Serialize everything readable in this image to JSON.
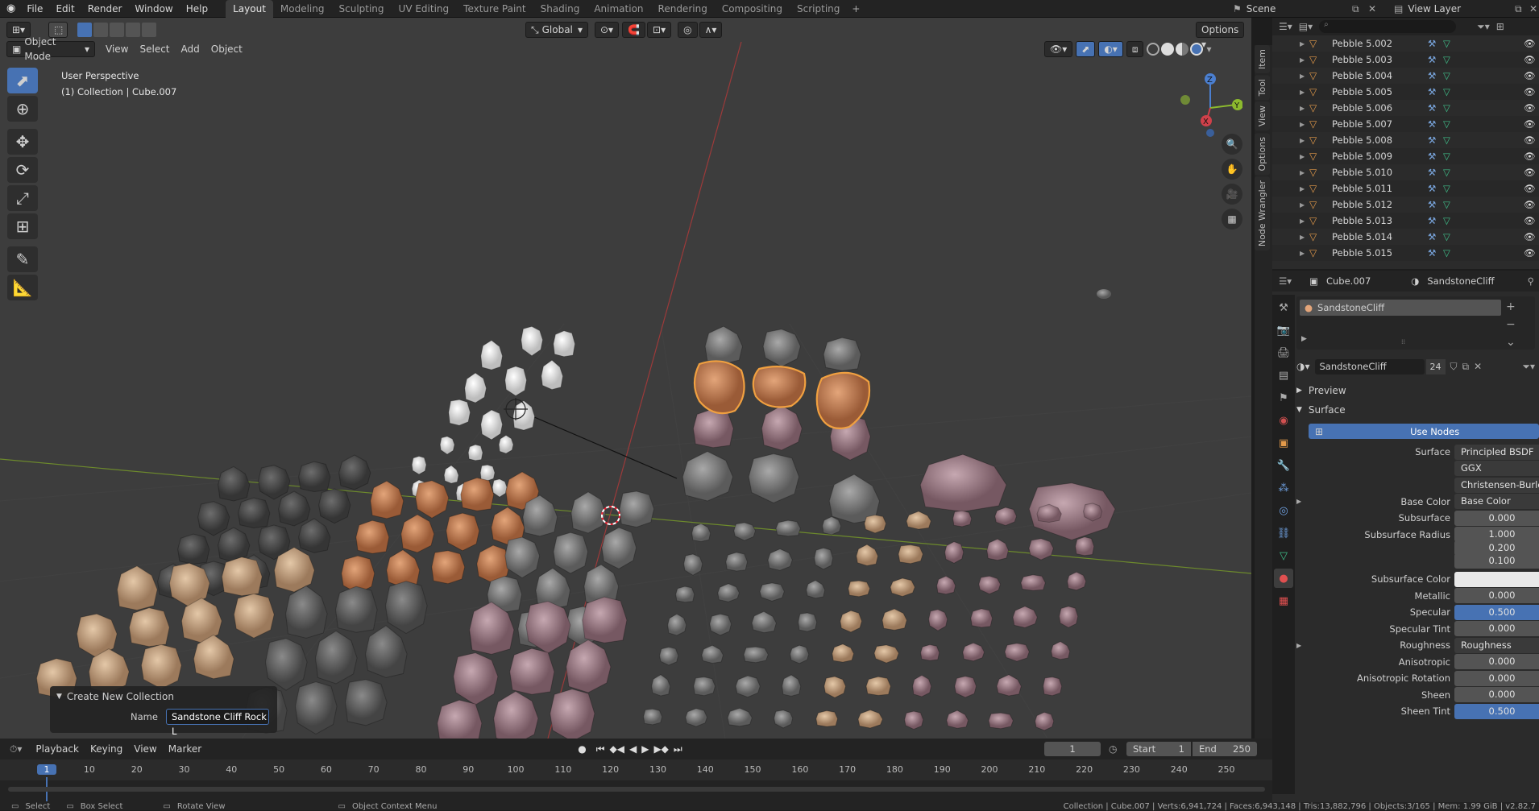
{
  "topbar": {
    "menus": [
      "File",
      "Edit",
      "Render",
      "Window",
      "Help"
    ],
    "workspaces": [
      "Layout",
      "Modeling",
      "Sculpting",
      "UV Editing",
      "Texture Paint",
      "Shading",
      "Animation",
      "Rendering",
      "Compositing",
      "Scripting"
    ],
    "active_workspace": "Layout",
    "plus": "+",
    "scene": "Scene",
    "view_layer": "View Layer"
  },
  "viewport": {
    "mode": "Object Mode",
    "menus": [
      "View",
      "Select",
      "Add",
      "Object"
    ],
    "transform_orientation": "Global",
    "options": "Options",
    "info_line1": "User Perspective",
    "info_line2": "(1) Collection | Cube.007",
    "gizmo": {
      "z": "Z",
      "y": "Y",
      "x": "X"
    },
    "side_tabs": [
      "Item",
      "Tool",
      "View",
      "Options",
      "Node Wrangler"
    ]
  },
  "popup": {
    "title": "Create New Collection",
    "name_label": "Name",
    "name_value": "Sandstone Cliff Rock L"
  },
  "outliner": {
    "items": [
      "Pebble 5.002",
      "Pebble 5.003",
      "Pebble 5.004",
      "Pebble 5.005",
      "Pebble 5.006",
      "Pebble 5.007",
      "Pebble 5.008",
      "Pebble 5.009",
      "Pebble 5.010",
      "Pebble 5.011",
      "Pebble 5.012",
      "Pebble 5.013",
      "Pebble 5.014",
      "Pebble 5.015"
    ]
  },
  "properties": {
    "object": "Cube.007",
    "material": "SandstoneCliff",
    "slot": "SandstoneCliff",
    "material_name": "SandstoneCliff",
    "users": "24",
    "preview": "Preview",
    "surface_panel": "Surface",
    "use_nodes": "Use Nodes",
    "rows": [
      {
        "label": "Surface",
        "value": "Principled BSDF",
        "style": "dark"
      },
      {
        "label": "",
        "value": "GGX",
        "style": "dark"
      },
      {
        "label": "",
        "value": "Christensen-Burley",
        "style": "dark"
      },
      {
        "label": "Base Color",
        "value": "Base Color",
        "style": "dark"
      },
      {
        "label": "Subsurface",
        "value": "0.000",
        "style": "num"
      },
      {
        "label": "Subsurface Radius",
        "value": "1.000",
        "style": "num"
      },
      {
        "label": "",
        "value": "0.200",
        "style": "num"
      },
      {
        "label": "",
        "value": "0.100",
        "style": "num"
      },
      {
        "label": "Subsurface Color",
        "value": "",
        "style": "white"
      },
      {
        "label": "Metallic",
        "value": "0.000",
        "style": "num"
      },
      {
        "label": "Specular",
        "value": "0.500",
        "style": "blue"
      },
      {
        "label": "Specular Tint",
        "value": "0.000",
        "style": "num"
      },
      {
        "label": "Roughness",
        "value": "Roughness",
        "style": "dark"
      },
      {
        "label": "Anisotropic",
        "value": "0.000",
        "style": "num"
      },
      {
        "label": "Anisotropic Rotation",
        "value": "0.000",
        "style": "num"
      },
      {
        "label": "Sheen",
        "value": "0.000",
        "style": "num"
      },
      {
        "label": "Sheen Tint",
        "value": "0.500",
        "style": "blue"
      }
    ]
  },
  "timeline": {
    "menus": [
      "Playback",
      "Keying",
      "View",
      "Marker"
    ],
    "current_frame": "1",
    "start_label": "Start",
    "start": "1",
    "end_label": "End",
    "end": "250",
    "ticks": [
      "1",
      "10",
      "20",
      "30",
      "40",
      "50",
      "60",
      "70",
      "80",
      "90",
      "100",
      "110",
      "120",
      "130",
      "140",
      "150",
      "160",
      "170",
      "180",
      "190",
      "200",
      "210",
      "220",
      "230",
      "240",
      "250"
    ]
  },
  "statusbar": {
    "select": "Select",
    "box_select": "Box Select",
    "rotate_view": "Rotate View",
    "context_menu": "Object Context Menu",
    "stats": "Collection | Cube.007 | Verts:6,941,724 | Faces:6,943,148 | Tris:13,882,796 | Objects:3/165 | Mem: 1.99 GiB | v2.82.7"
  }
}
